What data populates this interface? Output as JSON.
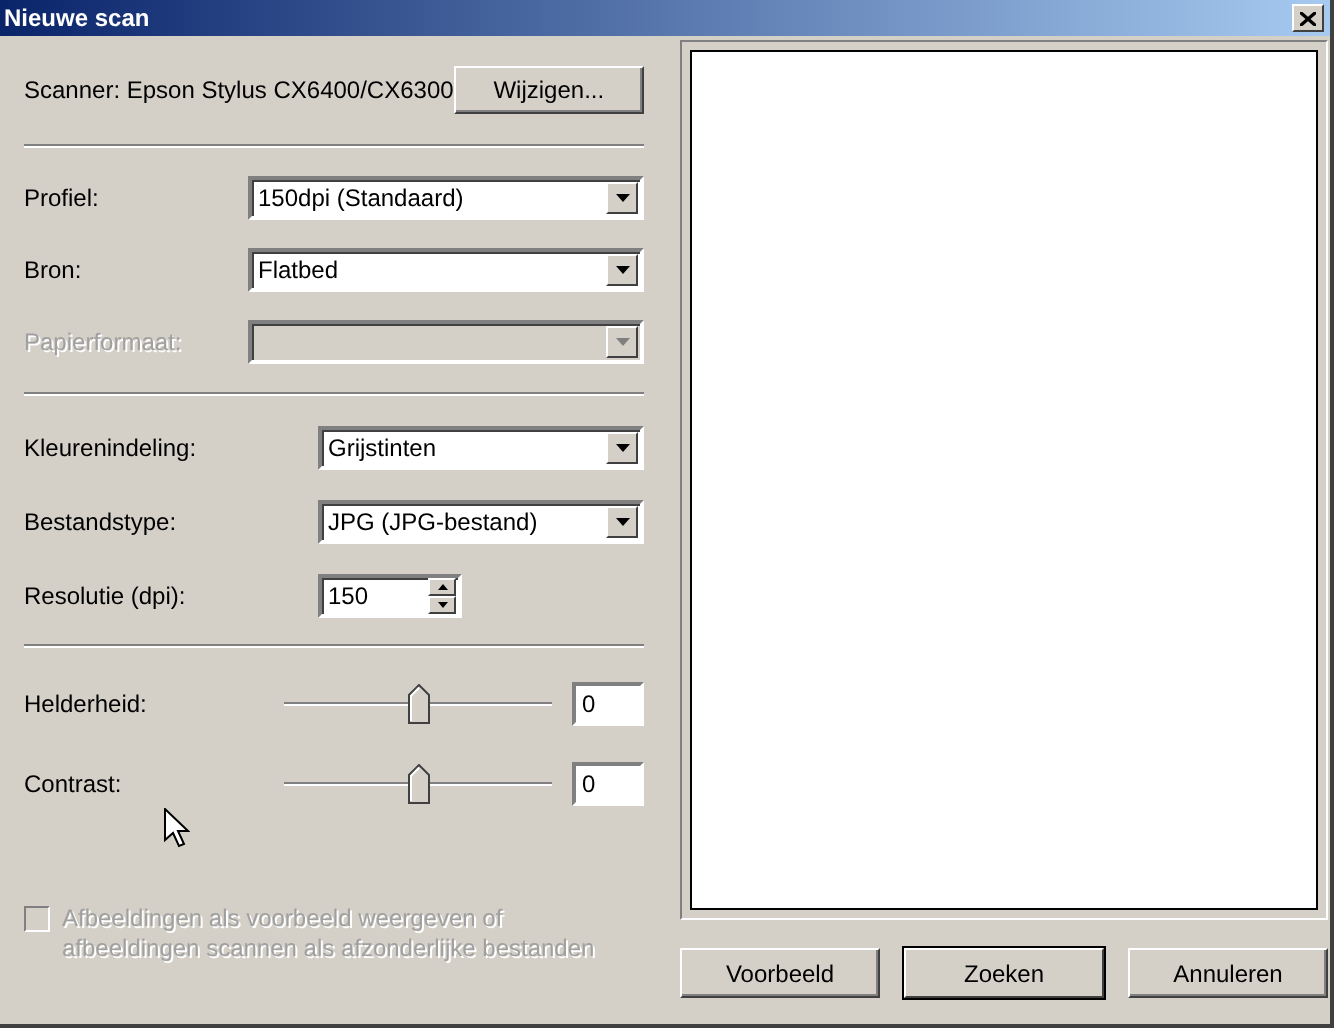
{
  "window": {
    "title": "Nieuwe scan"
  },
  "scanner": {
    "label": "Scanner: Epson Stylus CX6400/CX6300",
    "button": "Wijzigen..."
  },
  "sections": [
    {
      "fields": [
        {
          "kind": "dropdown",
          "label": "Profiel:",
          "value": "150dpi (Standaard)",
          "disabled": false
        },
        {
          "kind": "dropdown",
          "label": "Bron:",
          "value": "Flatbed",
          "disabled": false
        },
        {
          "kind": "dropdown",
          "label": "Papierformaat:",
          "disabled": true
        }
      ]
    },
    {
      "fields": [
        {
          "kind": "dropdown",
          "label": "Kleurenindeling:",
          "value": "Grijstinten",
          "disabled": false
        },
        {
          "kind": "dropdown",
          "label": "Bestandstype:",
          "value": "JPG (JPG-bestand)",
          "disabled": false
        },
        {
          "kind": "spin",
          "label": "Resolutie (dpi):",
          "value": "150",
          "disabled": false
        }
      ]
    }
  ],
  "sliders": [
    {
      "label": "Helderheid:",
      "level": 0.5,
      "value": "0"
    },
    {
      "label": "Contrast:",
      "level": 0.5,
      "value": "0"
    }
  ],
  "option": {
    "label": "Afbeeldingen als voorbeeld weergeven of afbeeldingen scannen als afzonderlijke bestanden",
    "checked": false,
    "disabled": true
  },
  "buttons": [
    {
      "label": "Voorbeeld",
      "default": false
    },
    {
      "label": "Zoeken",
      "default": true
    },
    {
      "label": "Annuleren",
      "default": false
    }
  ]
}
